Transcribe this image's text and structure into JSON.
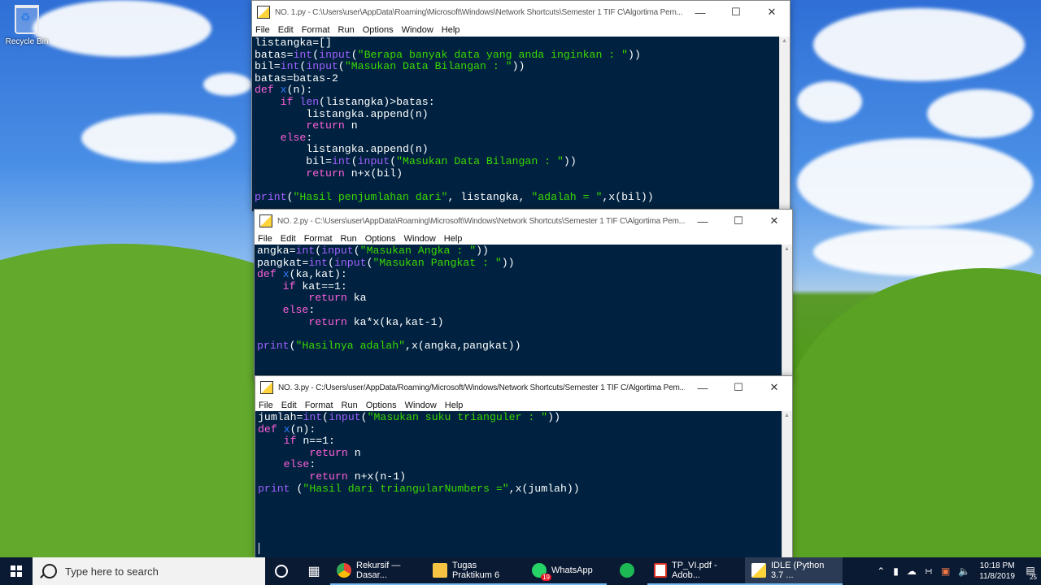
{
  "desktop": {
    "recycle_bin_label": "Recycle Bin"
  },
  "windows": {
    "w1": {
      "title": "NO. 1.py - C:\\Users\\user\\AppData\\Roaming\\Microsoft\\Windows\\Network Shortcuts\\Semester 1 TIF C\\Algortima Pem...",
      "menu": [
        "File",
        "Edit",
        "Format",
        "Run",
        "Options",
        "Window",
        "Help"
      ]
    },
    "w2": {
      "title": "NO. 2.py - C:\\Users\\user\\AppData\\Roaming\\Microsoft\\Windows\\Network Shortcuts\\Semester 1 TIF C\\Algortima Pem...",
      "menu": [
        "File",
        "Edit",
        "Format",
        "Run",
        "Options",
        "Window",
        "Help"
      ]
    },
    "w3": {
      "title": "NO. 3.py - C:/Users/user/AppData/Roaming/Microsoft/Windows/Network Shortcuts/Semester 1 TIF C/Algortima Pem...",
      "menu": [
        "File",
        "Edit",
        "Format",
        "Run",
        "Options",
        "Window",
        "Help"
      ]
    }
  },
  "taskbar": {
    "search_placeholder": "Type here to search",
    "apps": [
      {
        "label": "Rekursif — Dasar..."
      },
      {
        "label": "Tugas Praktikum 6"
      },
      {
        "label": "WhatsApp",
        "badge": "19"
      },
      {
        "label": ""
      },
      {
        "label": "TP_VI.pdf - Adob..."
      },
      {
        "label": "IDLE (Python 3.7 ..."
      }
    ],
    "time": "10:18 PM",
    "date": "11/8/2019",
    "notifications": "25"
  }
}
